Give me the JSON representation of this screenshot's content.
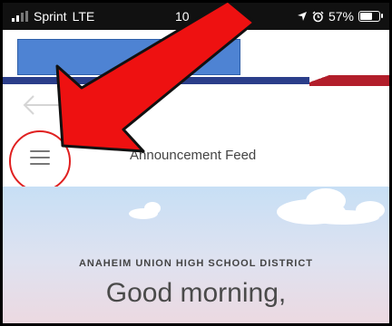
{
  "status_bar": {
    "carrier": "Sprint",
    "network": "LTE",
    "time": "10",
    "battery_percent": "57%",
    "battery_level": 0.57
  },
  "header": {
    "feed_title": "Announcement Feed"
  },
  "hero": {
    "district": "ANAHEIM UNION HIGH SCHOOL DISTRICT",
    "greeting": "Good morning,"
  },
  "colors": {
    "highlight_red": "#e02020",
    "stripe_blue": "#2b3e8a",
    "stripe_red": "#b21e2b",
    "redacted_box": "#4e83d3"
  },
  "icons": {
    "menu": "hamburger-icon",
    "back": "back-arrow-icon",
    "location": "location-arrow-icon",
    "alarm": "alarm-icon"
  }
}
